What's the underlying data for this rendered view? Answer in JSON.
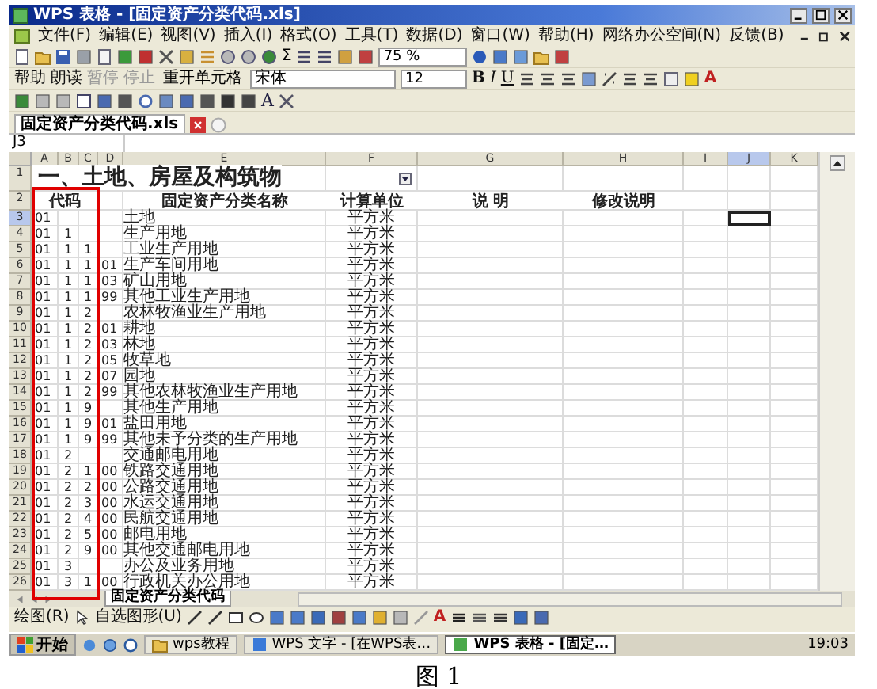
{
  "window": {
    "title": "WPS 表格 - [固定资产分类代码.xls]"
  },
  "menu": [
    "文件(F)",
    "编辑(E)",
    "视图(V)",
    "插入(I)",
    "格式(O)",
    "工具(T)",
    "数据(D)",
    "窗口(W)",
    "帮助(H)",
    "网络办公空间(N)",
    "反馈(B)"
  ],
  "toolbar": {
    "sum": "Σ",
    "zoom": "75 %",
    "font": "宋体",
    "size": "12",
    "merge": "重开单元格",
    "format_buttons": [
      "B",
      "I",
      "U"
    ],
    "font_color": "A",
    "wordart": "A",
    "buttons": [
      {
        "label": "帮助",
        "disabled": false
      },
      {
        "label": "朗读",
        "disabled": false
      },
      {
        "label": "暂停",
        "disabled": true
      },
      {
        "label": "停止",
        "disabled": true
      }
    ]
  },
  "doc_tabs": [
    {
      "label": "固定资产分类代码.xls",
      "selected": true
    }
  ],
  "name_box": "J3",
  "columns": [
    {
      "label": "A",
      "selected": false
    },
    {
      "label": "B",
      "selected": false
    },
    {
      "label": "C",
      "selected": false
    },
    {
      "label": "D",
      "selected": false
    },
    {
      "label": "E",
      "selected": false
    },
    {
      "label": "F",
      "selected": false
    },
    {
      "label": "G",
      "selected": false
    },
    {
      "label": "H",
      "selected": false
    },
    {
      "label": "I",
      "selected": false
    },
    {
      "label": "J",
      "selected": true
    },
    {
      "label": "K",
      "selected": false
    }
  ],
  "sheet_title": {
    "row": "1",
    "text": "一、土地、房屋及构筑物"
  },
  "header_row": {
    "row": "2",
    "code": "代码",
    "name": "固定资产分类名称",
    "unit": "计算单位",
    "note": "说 明",
    "revision": "修改说明"
  },
  "rows": [
    {
      "row": "3",
      "selected": true,
      "codes": {
        "A": "01"
      },
      "name": "土地",
      "unit": "平方米"
    },
    {
      "row": "4",
      "selected": false,
      "codes": {
        "A": "01",
        "B": "1"
      },
      "name": "生产用地",
      "unit": "平方米"
    },
    {
      "row": "5",
      "selected": false,
      "codes": {
        "A": "01",
        "B": "1",
        "C": "1"
      },
      "name": "工业生产用地",
      "unit": "平方米"
    },
    {
      "row": "6",
      "selected": false,
      "codes": {
        "A": "01",
        "B": "1",
        "C": "1",
        "D": "01"
      },
      "name": "生产车间用地",
      "unit": "平方米"
    },
    {
      "row": "7",
      "selected": false,
      "codes": {
        "A": "01",
        "B": "1",
        "C": "1",
        "D": "03"
      },
      "name": "矿山用地",
      "unit": "平方米"
    },
    {
      "row": "8",
      "selected": false,
      "codes": {
        "A": "01",
        "B": "1",
        "C": "1",
        "D": "99"
      },
      "name": "其他工业生产用地",
      "unit": "平方米"
    },
    {
      "row": "9",
      "selected": false,
      "codes": {
        "A": "01",
        "B": "1",
        "C": "2"
      },
      "name": "农林牧渔业生产用地",
      "unit": "平方米"
    },
    {
      "row": "10",
      "selected": false,
      "codes": {
        "A": "01",
        "B": "1",
        "C": "2",
        "D": "01"
      },
      "name": "耕地",
      "unit": "平方米"
    },
    {
      "row": "11",
      "selected": false,
      "codes": {
        "A": "01",
        "B": "1",
        "C": "2",
        "D": "03"
      },
      "name": "林地",
      "unit": "平方米"
    },
    {
      "row": "12",
      "selected": false,
      "codes": {
        "A": "01",
        "B": "1",
        "C": "2",
        "D": "05"
      },
      "name": "牧草地",
      "unit": "平方米"
    },
    {
      "row": "13",
      "selected": false,
      "codes": {
        "A": "01",
        "B": "1",
        "C": "2",
        "D": "07"
      },
      "name": "园地",
      "unit": "平方米"
    },
    {
      "row": "14",
      "selected": false,
      "codes": {
        "A": "01",
        "B": "1",
        "C": "2",
        "D": "99"
      },
      "name": "其他农林牧渔业生产用地",
      "unit": "平方米"
    },
    {
      "row": "15",
      "selected": false,
      "codes": {
        "A": "01",
        "B": "1",
        "C": "9"
      },
      "name": "其他生产用地",
      "unit": "平方米"
    },
    {
      "row": "16",
      "selected": false,
      "codes": {
        "A": "01",
        "B": "1",
        "C": "9",
        "D": "01"
      },
      "name": "盐田用地",
      "unit": "平方米"
    },
    {
      "row": "17",
      "selected": false,
      "codes": {
        "A": "01",
        "B": "1",
        "C": "9",
        "D": "99"
      },
      "name": "其他未予分类的生产用地",
      "unit": "平方米"
    },
    {
      "row": "18",
      "selected": false,
      "codes": {
        "A": "01",
        "B": "2"
      },
      "name": "交通邮电用地",
      "unit": "平方米"
    },
    {
      "row": "19",
      "selected": false,
      "codes": {
        "A": "01",
        "B": "2",
        "C": "1",
        "D": "00"
      },
      "name": "铁路交通用地",
      "unit": "平方米"
    },
    {
      "row": "20",
      "selected": false,
      "codes": {
        "A": "01",
        "B": "2",
        "C": "2",
        "D": "00"
      },
      "name": "公路交通用地",
      "unit": "平方米"
    },
    {
      "row": "21",
      "selected": false,
      "codes": {
        "A": "01",
        "B": "2",
        "C": "3",
        "D": "00"
      },
      "name": "水运交通用地",
      "unit": "平方米"
    },
    {
      "row": "22",
      "selected": false,
      "codes": {
        "A": "01",
        "B": "2",
        "C": "4",
        "D": "00"
      },
      "name": "民航交通用地",
      "unit": "平方米"
    },
    {
      "row": "23",
      "selected": false,
      "codes": {
        "A": "01",
        "B": "2",
        "C": "5",
        "D": "00"
      },
      "name": "邮电用地",
      "unit": "平方米"
    },
    {
      "row": "24",
      "selected": false,
      "codes": {
        "A": "01",
        "B": "2",
        "C": "9",
        "D": "00"
      },
      "name": "其他交通邮电用地",
      "unit": "平方米"
    },
    {
      "row": "25",
      "selected": false,
      "codes": {
        "A": "01",
        "B": "3"
      },
      "name": "办公及业务用地",
      "unit": "平方米"
    },
    {
      "row": "26",
      "selected": false,
      "codes": {
        "A": "01",
        "B": "3",
        "C": "1",
        "D": "00"
      },
      "name": "行政机关办公用地",
      "unit": "平方米"
    }
  ],
  "sheet_tabs": [
    {
      "label": "固定资产分类代码",
      "selected": true
    }
  ],
  "draw_toolbar": {
    "draw": "绘图(R)",
    "shapes": "自选图形(U)",
    "font_color": "A"
  },
  "taskbar": {
    "start": "开始",
    "items": [
      {
        "label": "wps教程",
        "kind": "folder",
        "selected": false
      },
      {
        "label": "WPS 文字 - [在WPS表…",
        "kind": "writer",
        "selected": false
      },
      {
        "label": "WPS 表格 - [固定…",
        "kind": "sheet",
        "selected": true
      }
    ],
    "clock": "19:03"
  },
  "caption": "图 1"
}
